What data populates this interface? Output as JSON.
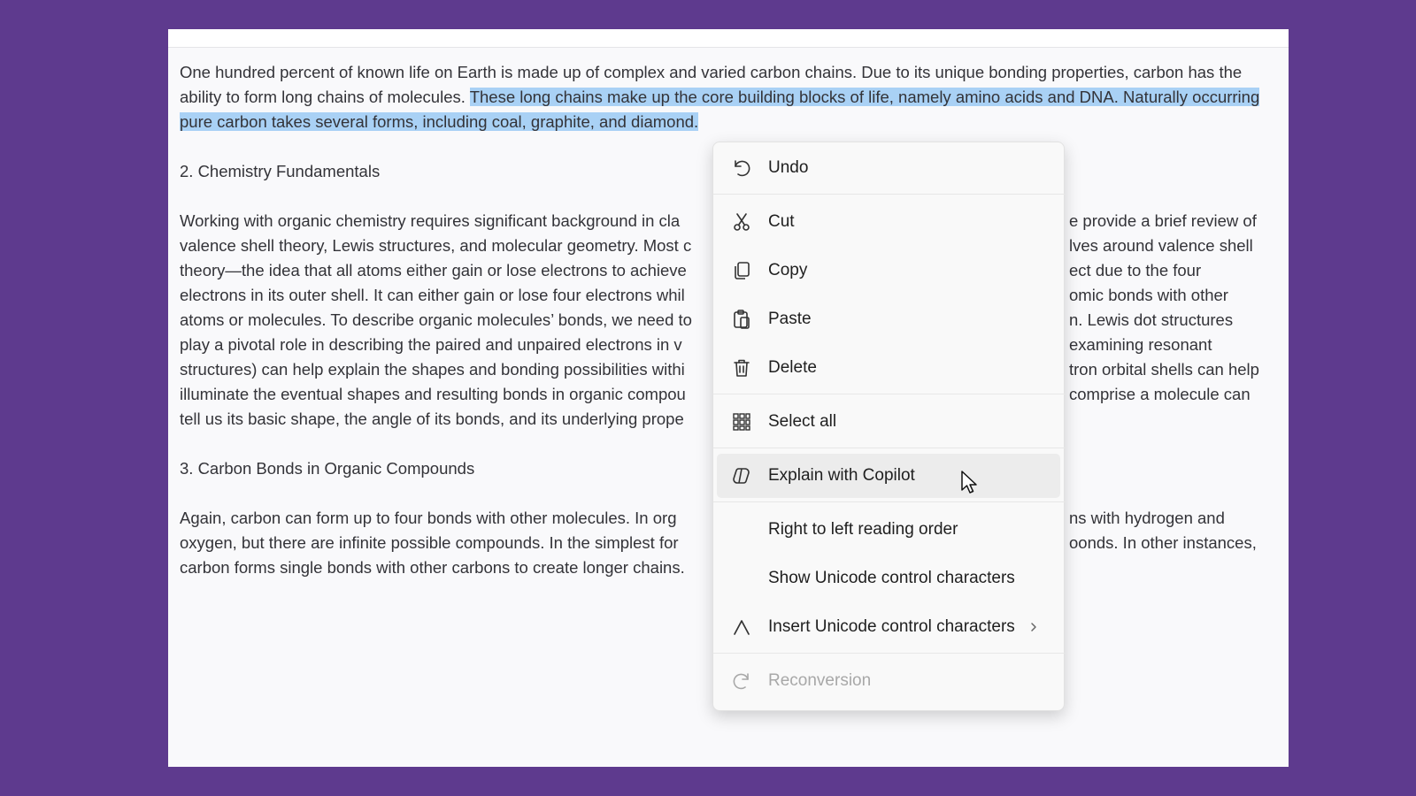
{
  "document": {
    "para1_part1": "One hundred percent of known life on Earth is made up of complex and varied carbon chains. Due to its unique bonding properties, carbon has the ability to form long chains of molecules. ",
    "para1_highlight": "These long chains make up the core building blocks of life, namely amino acids and DNA. Naturally occurring pure carbon takes several forms, including coal, graphite, and diamond.",
    "heading2": "2. Chemistry Fundamentals",
    "para2": "Working with organic chemistry requires significant background in cla                                                        e provide a brief review of valence shell theory, Lewis structures, and molecular geometry. Most c",
    "heading3": "3. Carbon Bonds in Organic Compounds",
    "lines2": [
      [
        "Working with organic chemistry requires significant background in cla",
        "e provide a brief review of"
      ],
      [
        "valence shell theory, Lewis structures, and molecular geometry. Most c",
        "lves around valence shell"
      ],
      [
        "theory—the idea that all atoms either gain or lose electrons to achieve",
        "ect due to the four"
      ],
      [
        "electrons in its outer shell. It can either gain or lose four electrons whil",
        "omic bonds with other"
      ],
      [
        "atoms or molecules. To describe organic molecules’ bonds, we need to",
        "n. Lewis dot structures"
      ],
      [
        "play a pivotal role in describing the paired and unpaired electrons in v",
        "examining resonant"
      ],
      [
        "structures) can help explain the shapes and bonding possibilities withi",
        "tron orbital shells can help"
      ],
      [
        "illuminate the eventual shapes and resulting bonds in organic compou",
        "comprise a molecule can"
      ],
      [
        "tell us its basic shape, the angle of its bonds, and its underlying prope",
        ""
      ]
    ],
    "lines3": [
      [
        "Again, carbon can form up to four bonds with other molecules. In org",
        "ns with hydrogen and"
      ],
      [
        "oxygen, but there are infinite possible compounds. In the simplest for",
        "oonds. In other instances,"
      ],
      [
        "carbon forms single bonds with other carbons to create longer chains.",
        ""
      ]
    ]
  },
  "context_menu": {
    "items": [
      {
        "label": "Undo",
        "icon": "undo-icon"
      },
      {
        "label": "Cut",
        "icon": "cut-icon"
      },
      {
        "label": "Copy",
        "icon": "copy-icon"
      },
      {
        "label": "Paste",
        "icon": "paste-icon"
      },
      {
        "label": "Delete",
        "icon": "delete-icon"
      },
      {
        "label": "Select all",
        "icon": "select-all-icon"
      },
      {
        "label": "Explain with Copilot",
        "icon": "copilot-icon"
      },
      {
        "label": "Right to left reading order",
        "icon": ""
      },
      {
        "label": "Show Unicode control characters",
        "icon": ""
      },
      {
        "label": "Insert Unicode control characters",
        "icon": "insert-unicode-icon",
        "submenu": true
      },
      {
        "label": "Reconversion",
        "icon": "reconversion-icon",
        "disabled": true
      }
    ]
  },
  "colors": {
    "background": "#5e3a8e",
    "highlight": "#a9d1f5",
    "menu_bg": "#f9f9f9"
  }
}
